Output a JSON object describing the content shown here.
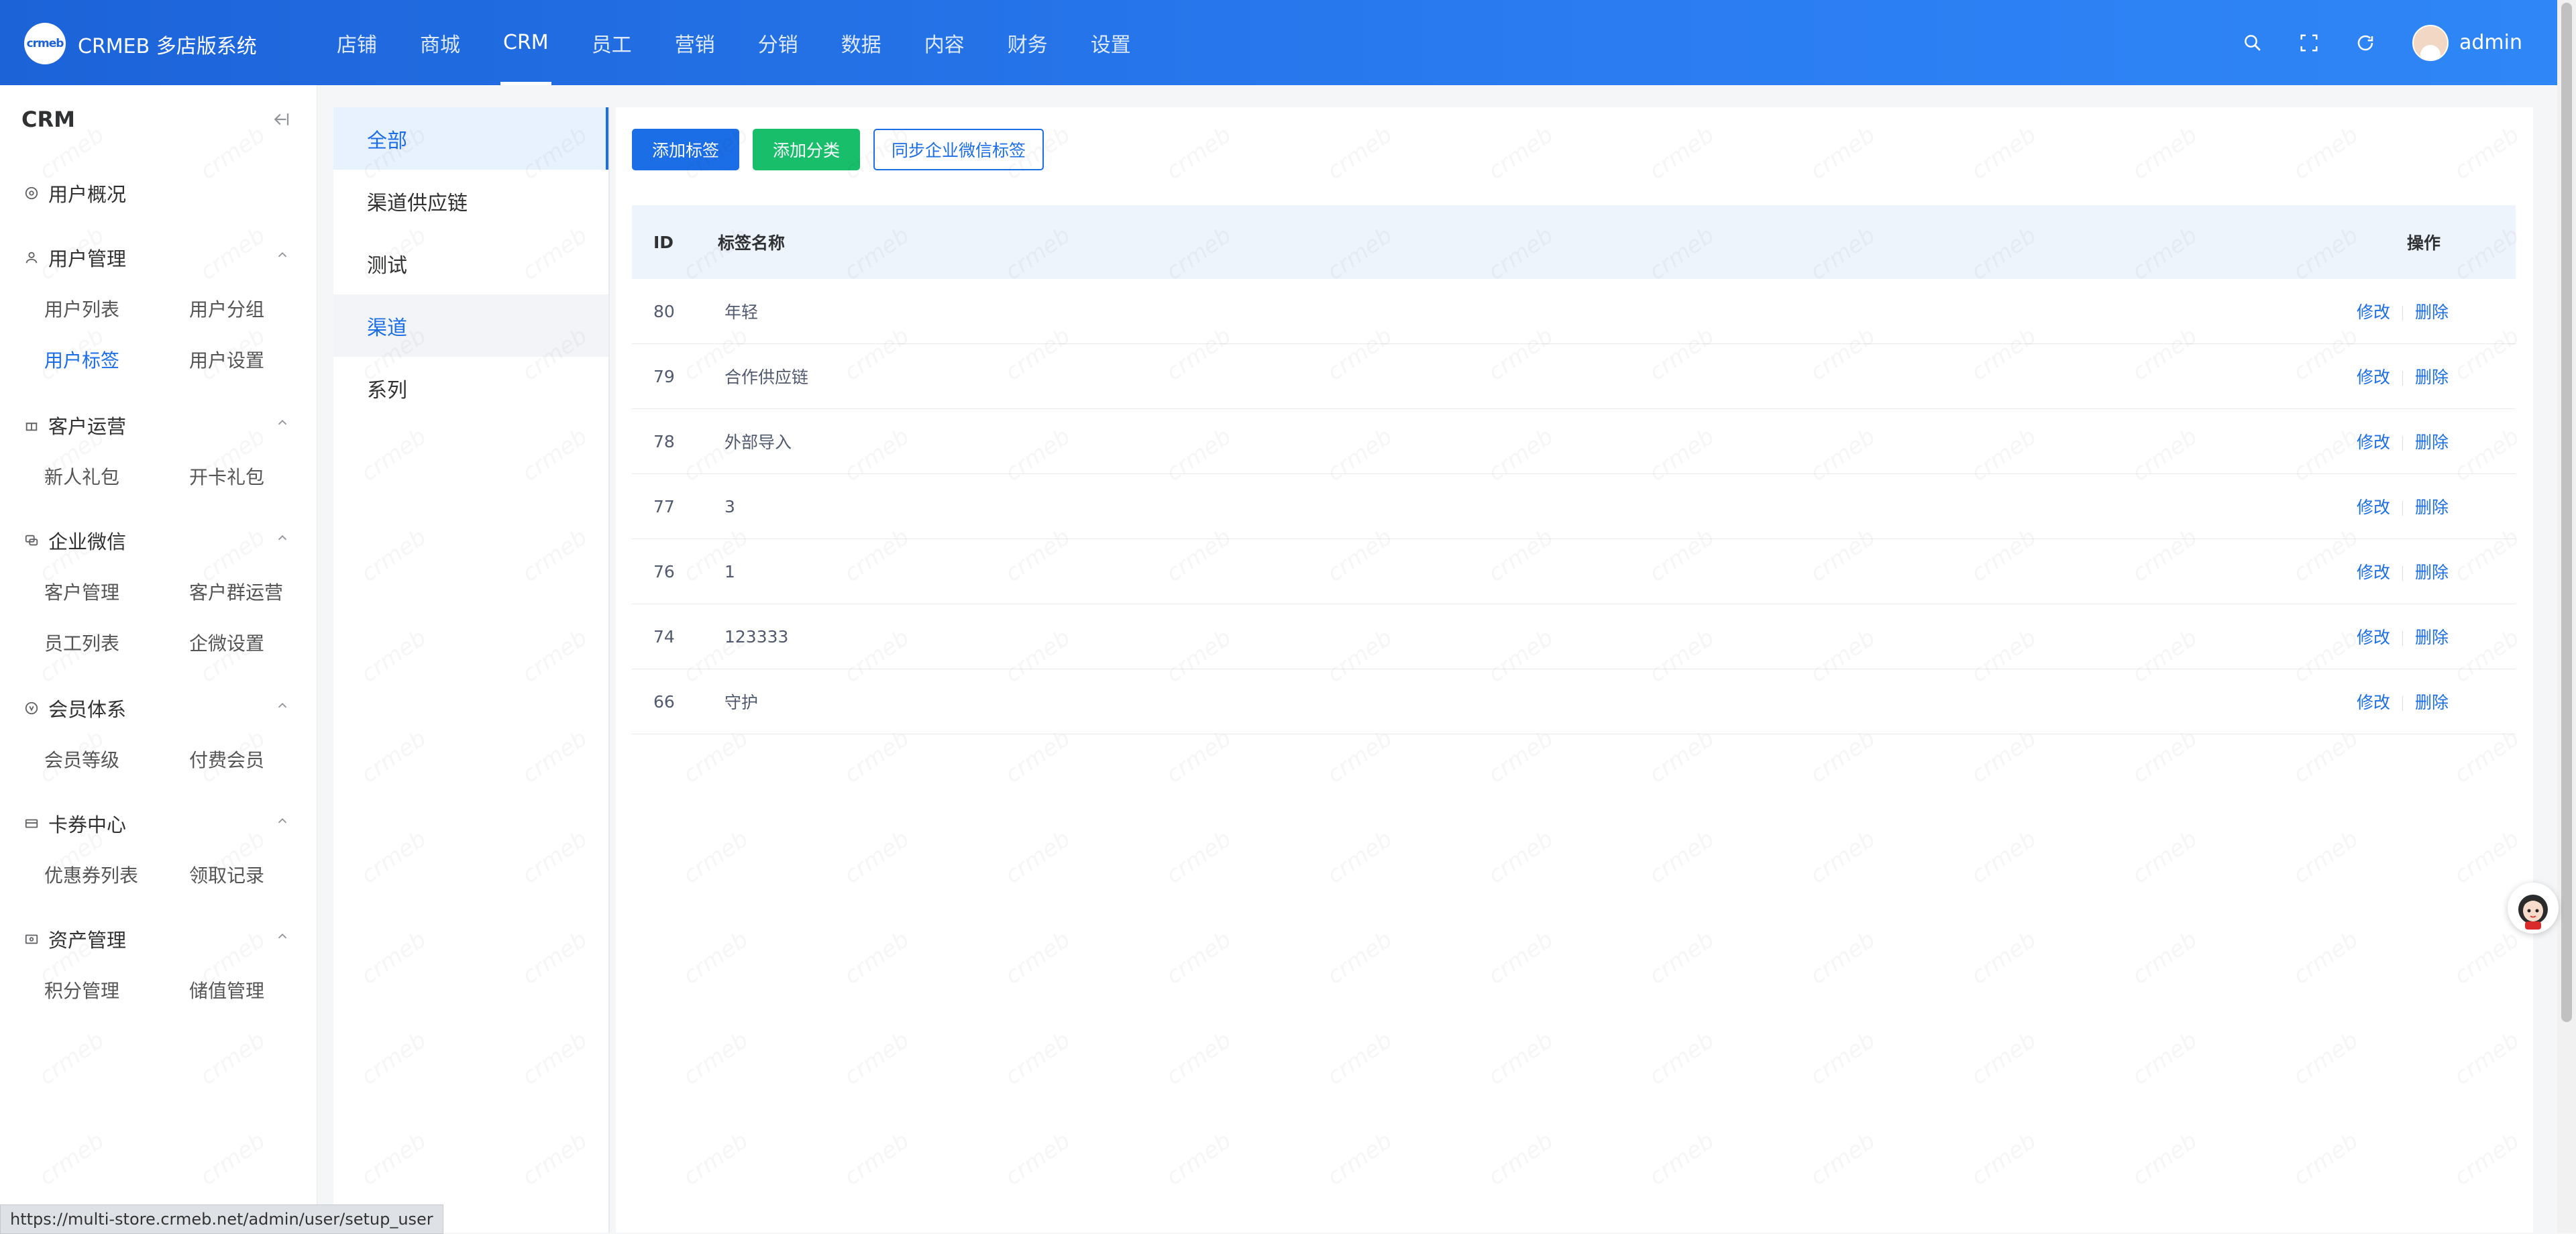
{
  "app": {
    "logo_text": "crmeb",
    "brand": "CRMEB 多店版系统",
    "user": "admin"
  },
  "topnav": [
    {
      "label": "店铺"
    },
    {
      "label": "商城"
    },
    {
      "label": "CRM"
    },
    {
      "label": "员工"
    },
    {
      "label": "营销"
    },
    {
      "label": "分销"
    },
    {
      "label": "数据"
    },
    {
      "label": "内容"
    },
    {
      "label": "财务"
    },
    {
      "label": "设置"
    }
  ],
  "sidebar": {
    "title": "CRM",
    "overview": "用户概况",
    "groups": [
      {
        "label": "用户管理",
        "items": [
          "用户列表",
          "用户分组",
          "用户标签",
          "用户设置"
        ]
      },
      {
        "label": "客户运营",
        "items": [
          "新人礼包",
          "开卡礼包"
        ]
      },
      {
        "label": "企业微信",
        "items": [
          "客户管理",
          "客户群运营",
          "员工列表",
          "企微设置"
        ]
      },
      {
        "label": "会员体系",
        "items": [
          "会员等级",
          "付费会员"
        ]
      },
      {
        "label": "卡券中心",
        "items": [
          "优惠券列表",
          "领取记录"
        ]
      },
      {
        "label": "资产管理",
        "items": [
          "积分管理",
          "储值管理"
        ]
      }
    ]
  },
  "categories": [
    "全部",
    "渠道供应链",
    "测试",
    "渠道",
    "系列"
  ],
  "toolbar": {
    "add_tag": "添加标签",
    "add_category": "添加分类",
    "sync_wechat": "同步企业微信标签"
  },
  "table": {
    "headers": {
      "id": "ID",
      "name": "标签名称",
      "op": "操作"
    },
    "edit_label": "修改",
    "delete_label": "删除",
    "rows": [
      {
        "id": "80",
        "name": "年轻"
      },
      {
        "id": "79",
        "name": "合作供应链"
      },
      {
        "id": "78",
        "name": "外部导入"
      },
      {
        "id": "77",
        "name": "3"
      },
      {
        "id": "76",
        "name": "1"
      },
      {
        "id": "74",
        "name": "123333"
      },
      {
        "id": "66",
        "name": "守护"
      }
    ]
  },
  "status_url": "https://multi-store.crmeb.net/admin/user/setup_user",
  "colors": {
    "primary": "#1c6ee6",
    "success": "#19be6b",
    "topbar": "#2a7bf0"
  }
}
